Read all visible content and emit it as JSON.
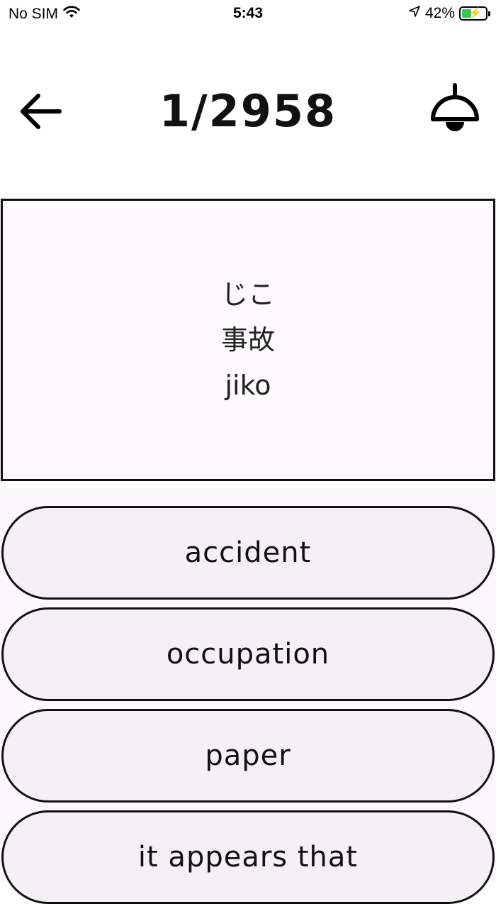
{
  "status_bar": {
    "carrier": "No SIM",
    "time": "5:43",
    "battery_percent": "42%",
    "battery_level": 0.42,
    "icons": [
      "wifi-icon",
      "location-arrow-icon",
      "battery-charging-icon"
    ]
  },
  "header": {
    "counter": "1/2958",
    "icons": [
      "back-arrow-icon",
      "lamp-icon"
    ]
  },
  "card": {
    "kana": "じこ",
    "kanji": "事故",
    "romaji": "jiko"
  },
  "answers": [
    {
      "label": "accident"
    },
    {
      "label": "occupation"
    },
    {
      "label": "paper"
    },
    {
      "label": "it appears that"
    }
  ],
  "colors": {
    "card_background": "#fcfafc",
    "answer_background": "#f4f0f6",
    "border": "#111111",
    "battery_fill": "#35c759"
  }
}
